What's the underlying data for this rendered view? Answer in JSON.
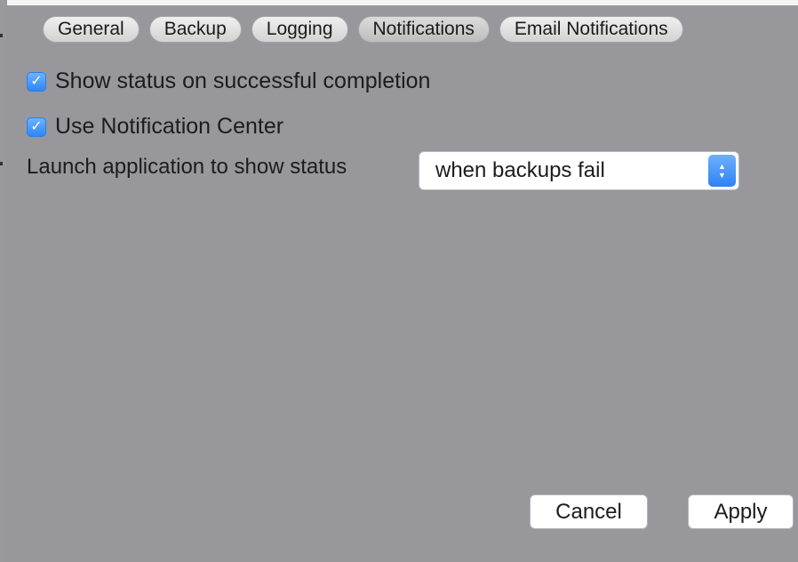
{
  "tabs": [
    {
      "label": "General"
    },
    {
      "label": "Backup"
    },
    {
      "label": "Logging"
    },
    {
      "label": "Notifications",
      "selected": true
    },
    {
      "label": "Email Notifications"
    }
  ],
  "options": {
    "show_status": {
      "label": "Show status on successful completion",
      "checked": true
    },
    "notification_center": {
      "label": "Use Notification Center",
      "checked": true
    }
  },
  "launch": {
    "label": "Launch application to show status",
    "value": "when backups fail"
  },
  "buttons": {
    "cancel": "Cancel",
    "apply": "Apply"
  },
  "icons": {
    "checkmark": "checkmark-icon",
    "popup_arrows": "up-down-chevron-icon"
  },
  "colors": {
    "background": "#98979c",
    "accent": "#3a8ef8"
  }
}
